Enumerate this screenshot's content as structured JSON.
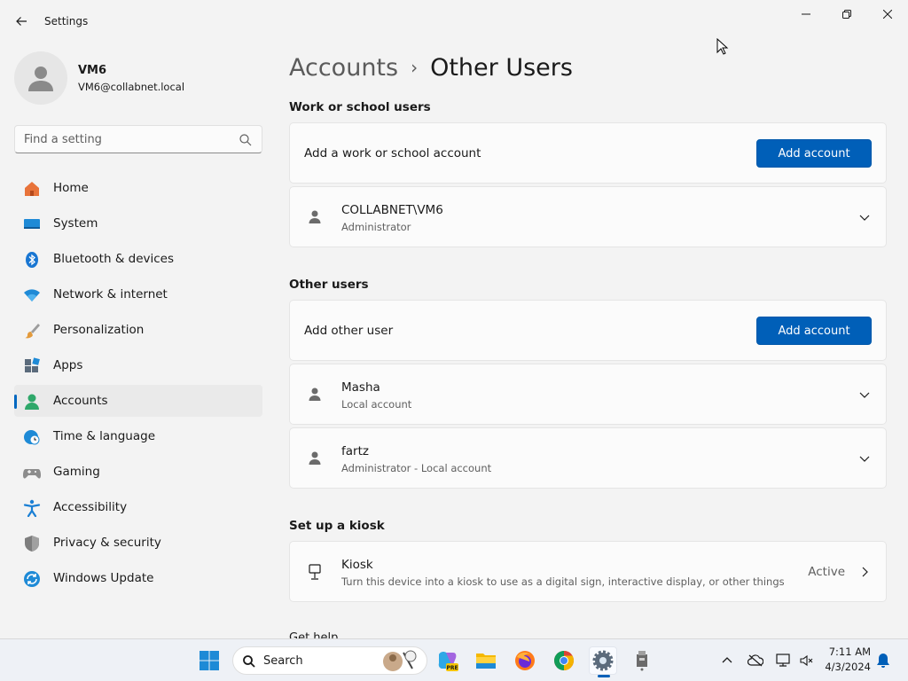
{
  "window": {
    "title": "Settings"
  },
  "profile": {
    "name": "VM6",
    "email": "VM6@collabnet.local"
  },
  "search": {
    "placeholder": "Find a setting"
  },
  "sidebar": {
    "items": [
      {
        "label": "Home",
        "icon": "home-icon",
        "selected": false
      },
      {
        "label": "System",
        "icon": "system-icon",
        "selected": false
      },
      {
        "label": "Bluetooth & devices",
        "icon": "bluetooth-icon",
        "selected": false
      },
      {
        "label": "Network & internet",
        "icon": "wifi-icon",
        "selected": false
      },
      {
        "label": "Personalization",
        "icon": "brush-icon",
        "selected": false
      },
      {
        "label": "Apps",
        "icon": "apps-icon",
        "selected": false
      },
      {
        "label": "Accounts",
        "icon": "accounts-icon",
        "selected": true
      },
      {
        "label": "Time & language",
        "icon": "globe-clock-icon",
        "selected": false
      },
      {
        "label": "Gaming",
        "icon": "gamepad-icon",
        "selected": false
      },
      {
        "label": "Accessibility",
        "icon": "accessibility-icon",
        "selected": false
      },
      {
        "label": "Privacy & security",
        "icon": "shield-icon",
        "selected": false
      },
      {
        "label": "Windows Update",
        "icon": "update-icon",
        "selected": false
      }
    ]
  },
  "breadcrumb": {
    "parent": "Accounts",
    "separator": "›",
    "current": "Other Users"
  },
  "work_school": {
    "section_title": "Work or school users",
    "add_label": "Add a work or school account",
    "add_button": "Add account",
    "users": [
      {
        "name": "COLLABNET\\VM6",
        "role": "Administrator"
      }
    ]
  },
  "other_users": {
    "section_title": "Other users",
    "add_label": "Add other user",
    "add_button": "Add account",
    "users": [
      {
        "name": "Masha",
        "role": "Local account"
      },
      {
        "name": "fartz",
        "role": "Administrator - Local account"
      }
    ]
  },
  "kiosk": {
    "section_title": "Set up a kiosk",
    "name": "Kiosk",
    "description": "Turn this device into a kiosk to use as a digital sign, interactive display, or other things",
    "status": "Active"
  },
  "partial_next": "Get help",
  "taskbar": {
    "search_label": "Search",
    "pinned": [
      "windows-start-icon",
      "copilot-icon",
      "file-explorer-icon",
      "firefox-icon",
      "chrome-icon",
      "settings-icon",
      "usb-device-icon"
    ],
    "time": "7:11 AM",
    "date": "4/3/2024"
  },
  "colors": {
    "accent": "#005fb8",
    "background": "#f3f3f3",
    "card": "#fbfbfb"
  }
}
